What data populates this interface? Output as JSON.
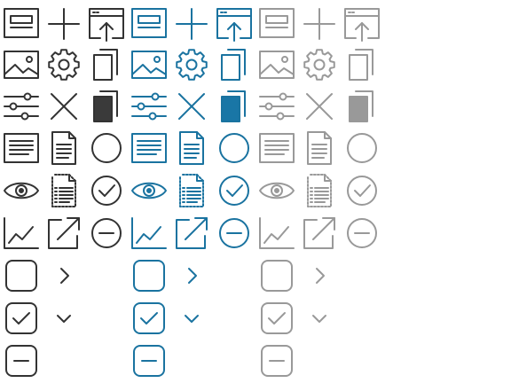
{
  "colors": {
    "dark": "#333333",
    "blue": "#1a73a0",
    "gray": "#999999",
    "dark_fill": "#3a3a3a",
    "blue_fill": "#1976a6",
    "gray_fill": "#999999"
  },
  "variants": [
    {
      "name": "dark",
      "color_key": "dark",
      "fill_key": "dark_fill"
    },
    {
      "name": "blue",
      "color_key": "blue",
      "fill_key": "blue_fill"
    },
    {
      "name": "gray",
      "color_key": "gray",
      "fill_key": "gray_fill"
    }
  ],
  "icon_grid": [
    [
      "panel-icon",
      "plus-icon",
      "upload-window-icon"
    ],
    [
      "image-icon",
      "gear-icon",
      "copy-icon"
    ],
    [
      "sliders-icon",
      "close-icon",
      "copy-filled-icon"
    ],
    [
      "text-block-icon",
      "document-icon",
      "circle-icon"
    ],
    [
      "eye-icon",
      "dotted-document-icon",
      "check-circle-icon"
    ],
    [
      "line-chart-icon",
      "external-link-icon",
      "minus-circle-icon"
    ],
    [
      "checkbox-empty-icon",
      "chevron-right-icon",
      ""
    ],
    [
      "checkbox-checked-icon",
      "chevron-down-icon",
      ""
    ],
    [
      "checkbox-indeterminate-icon",
      "",
      ""
    ]
  ]
}
